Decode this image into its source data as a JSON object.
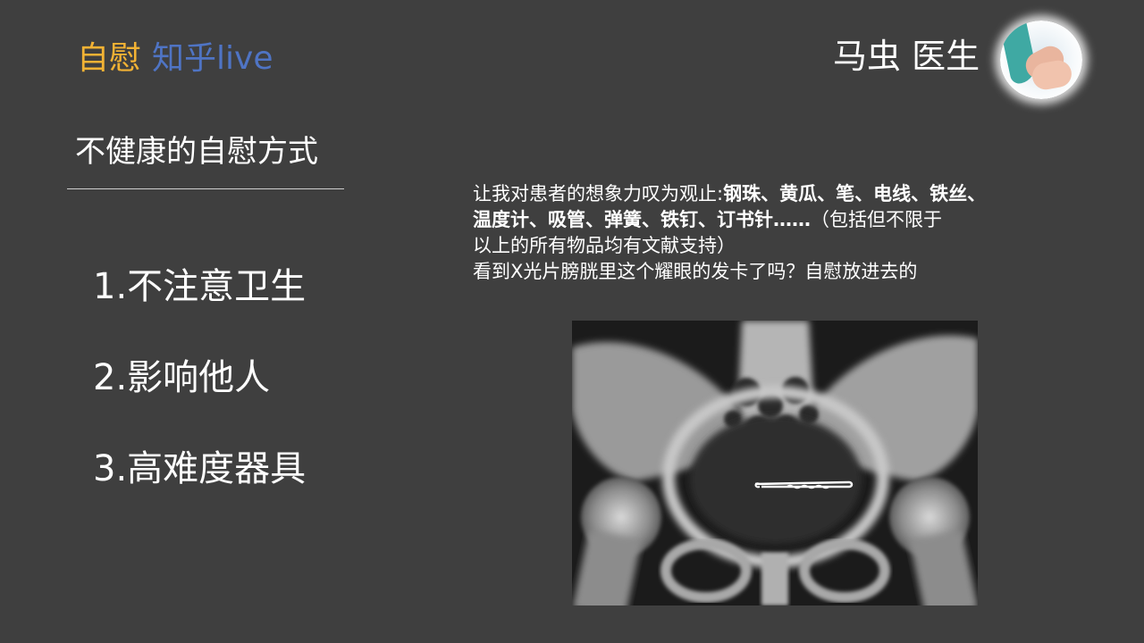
{
  "header": {
    "brand_part1": "自慰",
    "brand_part2": "知乎live",
    "author": "马虫 医生",
    "avatar_alt": "avatar"
  },
  "left": {
    "title": "不健康的自慰方式",
    "points": [
      "1.不注意卫生",
      "2.影响他人",
      "3.高难度器具"
    ]
  },
  "right": {
    "line1_normal": "让我对患者的想象力叹为观止:",
    "line1_bold": "钢珠、黄瓜、笔、电线、铁丝、",
    "line2_bold": "温度计、吸管、弹簧、铁钉、订书针……",
    "line2_normal": "（包括但不限于",
    "line3": "以上的所有物品均有文献支持）",
    "line4": "看到X光片膀胱里这个耀眼的发卡了吗？自慰放进去的"
  },
  "image": {
    "name": "pelvis-xray"
  },
  "colors": {
    "background": "#3f3f3f",
    "brand_yellow": "#f2b234",
    "brand_blue": "#4f74c4",
    "text": "#ffffff"
  }
}
